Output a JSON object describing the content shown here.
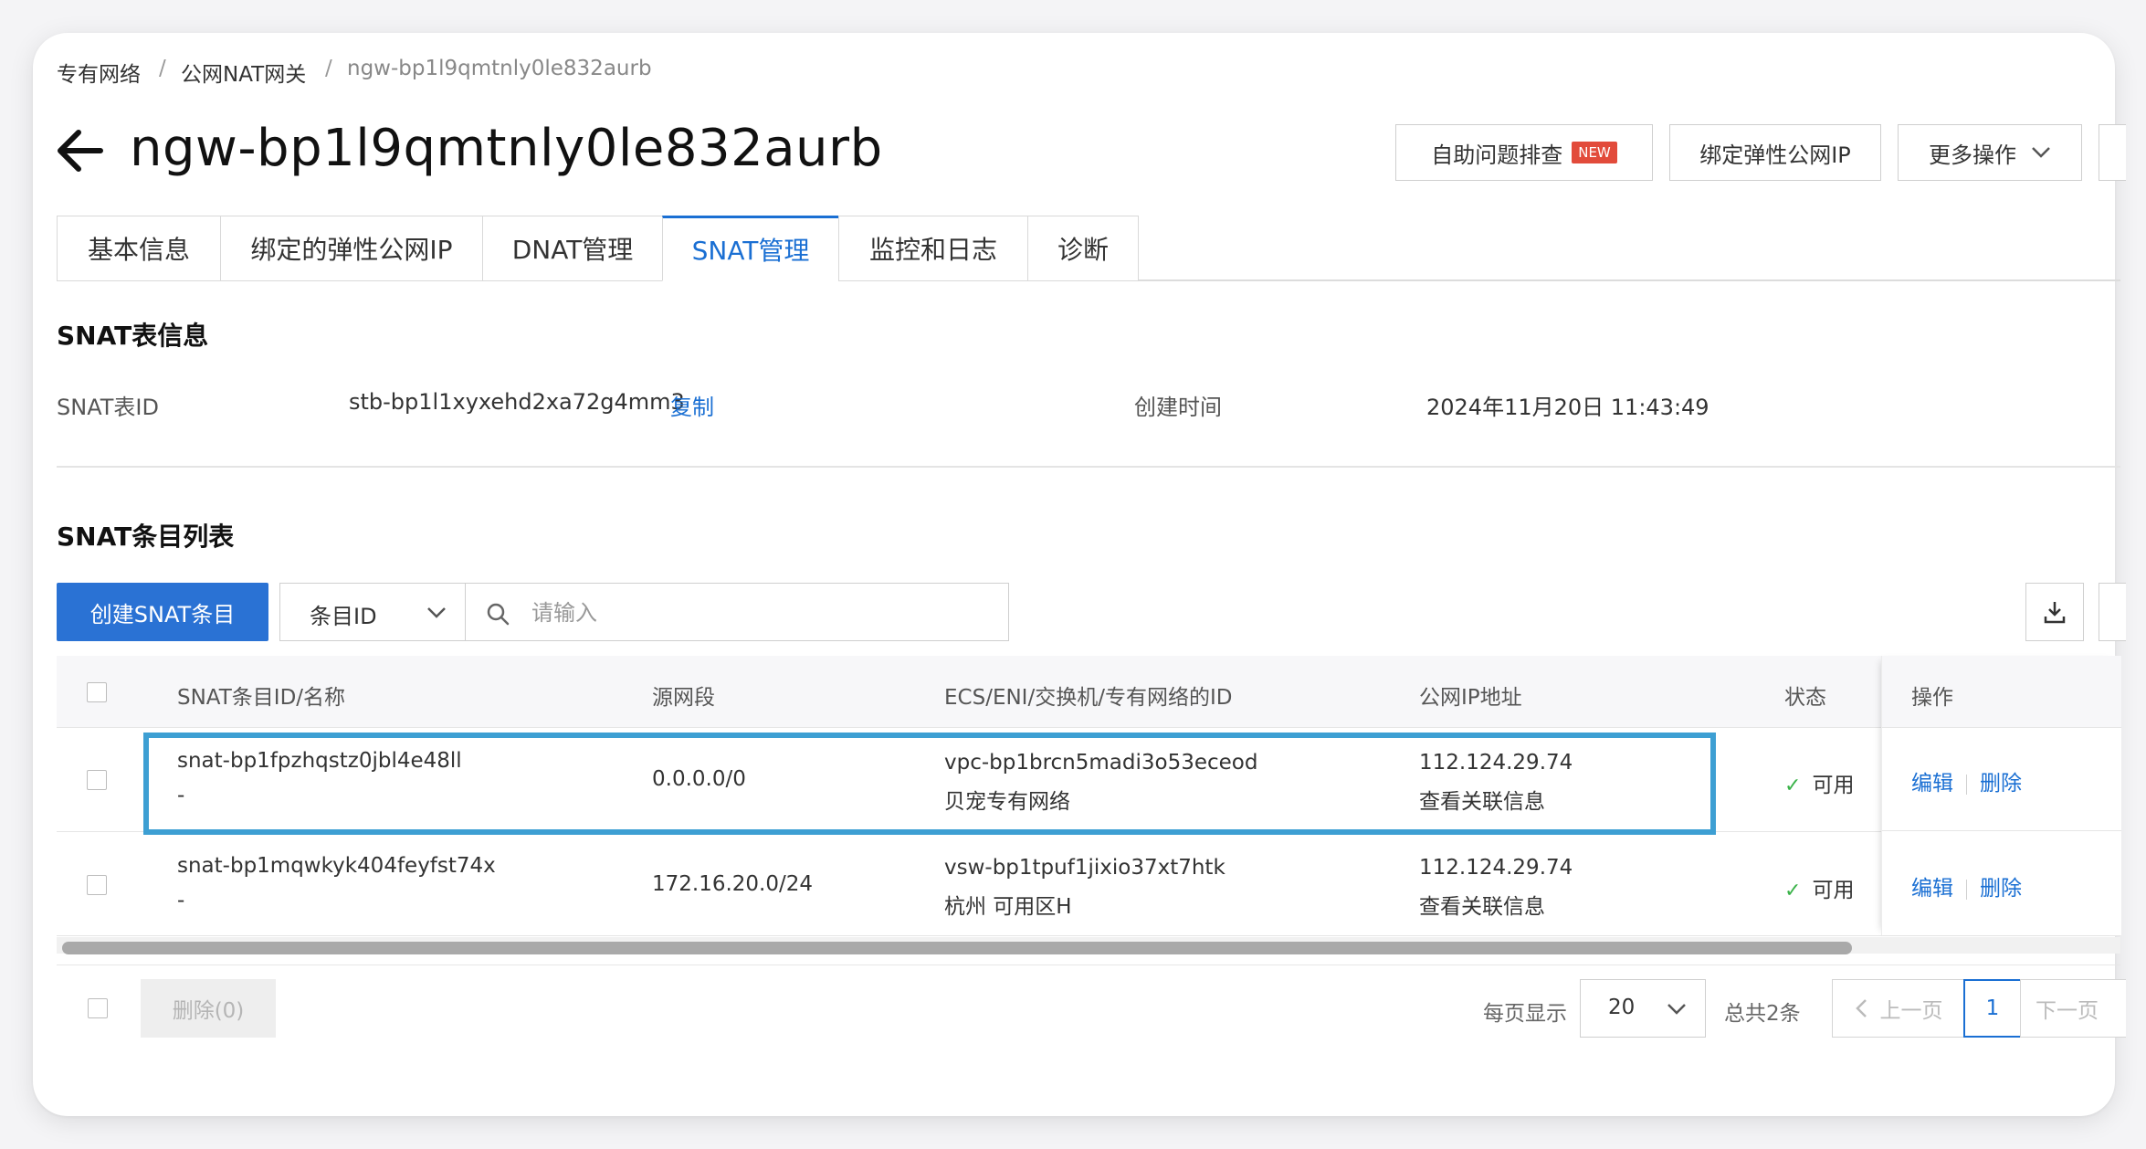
{
  "breadcrumb": {
    "items": [
      "专有网络",
      "公网NAT网关",
      "ngw-bp1l9qmtnly0le832aurb"
    ],
    "separator": "/"
  },
  "header": {
    "title": "ngw-bp1l9qmtnly0le832aurb",
    "buttons": {
      "self_check": "自助问题排查",
      "new_badge": "NEW",
      "bind_eip": "绑定弹性公网IP",
      "more": "更多操作"
    }
  },
  "tabs": [
    {
      "label": "基本信息",
      "active": false
    },
    {
      "label": "绑定的弹性公网IP",
      "active": false
    },
    {
      "label": "DNAT管理",
      "active": false
    },
    {
      "label": "SNAT管理",
      "active": true
    },
    {
      "label": "监控和日志",
      "active": false
    },
    {
      "label": "诊断",
      "active": false
    }
  ],
  "snat_info": {
    "section_title": "SNAT表信息",
    "table_id_label": "SNAT表ID",
    "table_id_value": "stb-bp1l1xyxehd2xa72g4mm3",
    "copy_label": "复制",
    "created_label": "创建时间",
    "created_value": "2024年11月20日 11:43:49"
  },
  "snat_list": {
    "section_title": "SNAT条目列表",
    "create_button": "创建SNAT条目",
    "filter_select": "条目ID",
    "search_placeholder": "请输入",
    "columns": [
      "SNAT条目ID/名称",
      "源网段",
      "ECS/ENI/交换机/专有网络的ID",
      "公网IP地址",
      "状态",
      "操作"
    ],
    "rows": [
      {
        "id": "snat-bp1fpzhqstz0jbl4e48ll",
        "name": "-",
        "source": "0.0.0.0/0",
        "resource_id": "vpc-bp1brcn5madi3o53eceod",
        "resource_name": "贝宠专有网络",
        "public_ip": "112.124.29.74",
        "related_link": "查看关联信息",
        "status": "可用",
        "edit": "编辑",
        "delete": "删除",
        "highlighted": true
      },
      {
        "id": "snat-bp1mqwkyk404feyfst74x",
        "name": "-",
        "source": "172.16.20.0/24",
        "resource_id": "vsw-bp1tpuf1jixio37xt7htk",
        "resource_name": "杭州 可用区H",
        "public_ip": "112.124.29.74",
        "related_link": "查看关联信息",
        "status": "可用",
        "edit": "编辑",
        "delete": "删除",
        "highlighted": false
      }
    ]
  },
  "footer": {
    "bulk_delete": "删除(0)",
    "page_size_label": "每页显示",
    "page_size": "20",
    "total": "总共2条",
    "prev": "上一页",
    "current_page": "1",
    "next": "下一页"
  },
  "colors": {
    "accent": "#1a6fd3",
    "primary_button": "#2a72d4",
    "highlight_border": "#3d9fd3",
    "status_ok": "#3bb34a",
    "new_badge": "#e24b3b"
  }
}
